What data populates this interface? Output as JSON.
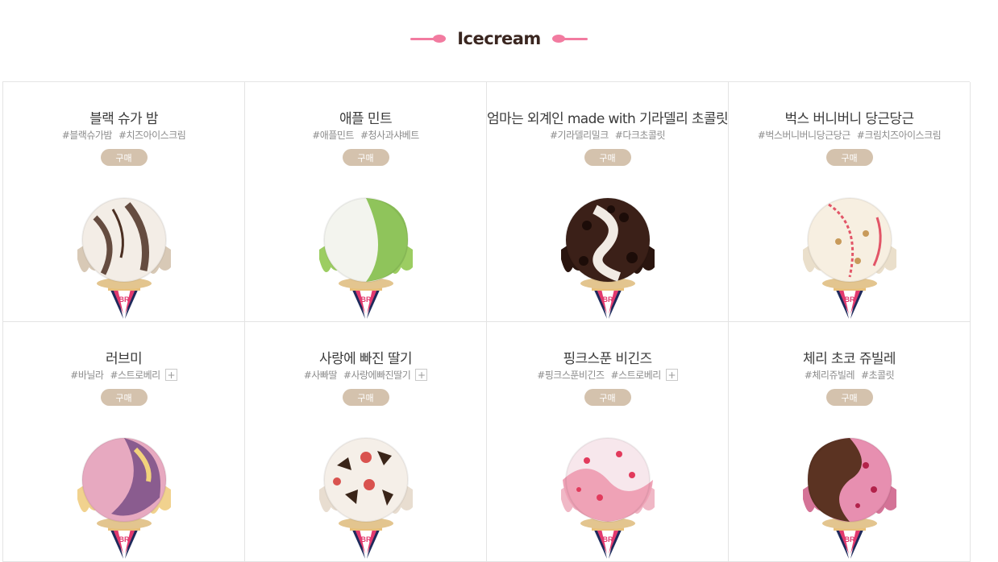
{
  "section": {
    "title": "Icecream"
  },
  "products": [
    {
      "name": "블랙 슈가 밤",
      "tags": [
        "#블랙슈가밤",
        "#치즈아이스크림"
      ],
      "has_more": false,
      "buy_label": "구매",
      "image_icon": "black-sugar-balm-scoop-icon",
      "colors": {
        "base": "#f3ede6",
        "accent": "#4b2f22",
        "rim": "#d8c9b6"
      }
    },
    {
      "name": "애플 민트",
      "tags": [
        "#애플민트",
        "#청사과샤베트"
      ],
      "has_more": false,
      "buy_label": "구매",
      "image_icon": "apple-mint-scoop-icon",
      "colors": {
        "base": "#f3f4ee",
        "accent": "#8fc45b",
        "rim": "#9ccd62"
      }
    },
    {
      "name": "엄마는 외계인 made with 기라델리 초콜릿",
      "tags": [
        "#기라델리밀크",
        "#다크초콜릿"
      ],
      "has_more": false,
      "buy_label": "구매",
      "image_icon": "mom-is-alien-scoop-icon",
      "colors": {
        "base": "#3b2018",
        "accent": "#f1ebe4",
        "rim": "#2a150f"
      }
    },
    {
      "name": "벅스 버니버니 당근당근",
      "tags": [
        "#벅스버니버니당근당근",
        "#크림치즈아이스크림"
      ],
      "has_more": false,
      "buy_label": "구매",
      "image_icon": "bugs-bunny-carrot-scoop-icon",
      "colors": {
        "base": "#f7efe1",
        "accent": "#e25567",
        "rim": "#eadfcb"
      }
    },
    {
      "name": "러브미",
      "tags": [
        "#바닐라",
        "#스트로베리"
      ],
      "has_more": true,
      "buy_label": "구매",
      "image_icon": "love-me-scoop-icon",
      "colors": {
        "base": "#e7a9c0",
        "accent": "#8a5c8f",
        "rim": "#f1d28e"
      }
    },
    {
      "name": "사랑에 빠진 딸기",
      "tags": [
        "#사빠딸",
        "#사랑에빠진딸기"
      ],
      "has_more": true,
      "buy_label": "구매",
      "image_icon": "strawberry-in-love-scoop-icon",
      "colors": {
        "base": "#f5efe8",
        "accent": "#3a2519",
        "rim": "#e8ddd0"
      }
    },
    {
      "name": "핑크스푼 비긴즈",
      "tags": [
        "#핑크스푼비긴즈",
        "#스트로베리"
      ],
      "has_more": true,
      "buy_label": "구매",
      "image_icon": "pink-spoon-begins-scoop-icon",
      "colors": {
        "base": "#f7e7ec",
        "accent": "#e23a5c",
        "rim": "#f0b8c6"
      }
    },
    {
      "name": "체리 초코 쥬빌레",
      "tags": [
        "#체리쥬빌레",
        "#초콜릿"
      ],
      "has_more": false,
      "buy_label": "구매",
      "image_icon": "cherry-choco-jubilee-scoop-icon",
      "colors": {
        "base": "#e78fb0",
        "accent": "#5b3322",
        "rim": "#d47397"
      }
    }
  ],
  "cone": {
    "icon": "br-cone-icon",
    "label": "BR",
    "colors": {
      "pink": "#e23a6e",
      "navy": "#1f2a5c",
      "white": "#ffffff"
    }
  },
  "colors": {
    "spoon": "#f27ba0",
    "title": "#3a2620",
    "buy_button": "#d4c2ad",
    "border": "#e4e4e4"
  }
}
